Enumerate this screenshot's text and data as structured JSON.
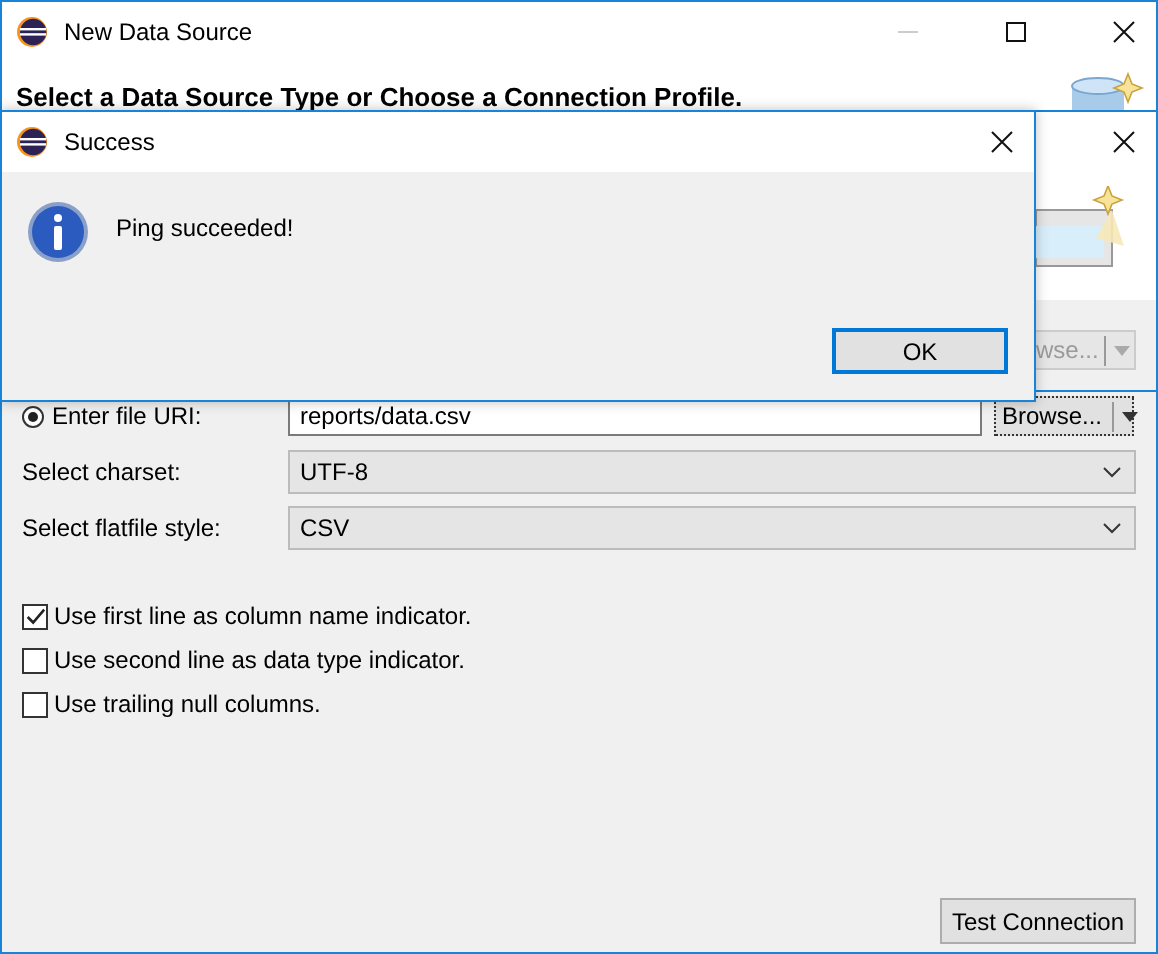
{
  "main_window": {
    "title": "New Data Source",
    "header": "Select a Data Source Type or Choose a Connection Profile."
  },
  "back_dialog": {
    "browse_button": {
      "label": "wse...",
      "disabled": true
    }
  },
  "success_dialog": {
    "title": "Success",
    "message": "Ping succeeded!",
    "buttons": [
      "OK"
    ]
  },
  "form": {
    "file_uri": {
      "label": "Enter file URI:",
      "selected": true,
      "value": "reports/data.csv",
      "browse": "Browse..."
    },
    "charset": {
      "label": "Select charset:",
      "value": "UTF-8"
    },
    "style": {
      "label": "Select flatfile style:",
      "value": "CSV"
    },
    "options": [
      {
        "label": "Use first line as column name indicator.",
        "checked": true
      },
      {
        "label": "Use second line as data type indicator.",
        "checked": false
      },
      {
        "label": "Use trailing null columns.",
        "checked": false
      }
    ]
  },
  "test_button": "Test Connection"
}
